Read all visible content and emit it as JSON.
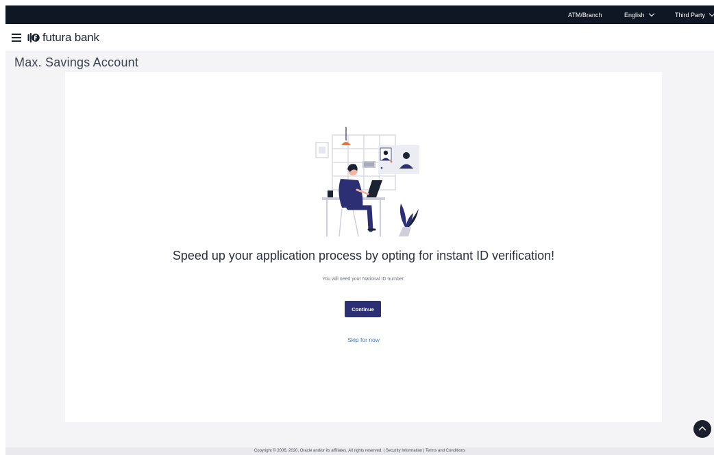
{
  "topbar": {
    "atm_branch": "ATM/Branch",
    "language": "English",
    "third_party": "Third Party"
  },
  "header": {
    "brand_name": "futura bank"
  },
  "page": {
    "title": "Max. Savings Account"
  },
  "main": {
    "headline": "Speed up your application process by opting for instant ID verification!",
    "subline": "You will need your National ID number.",
    "continue_label": "Continue",
    "skip_label": "Skip for now"
  },
  "footer": {
    "copyright": "Copyright © 2006, 2020, Oracle and/or its affiliates. All rights reserved.",
    "separator": " | ",
    "security_info": "Security Information",
    "terms": "Terms and Conditions"
  },
  "colors": {
    "topbar_bg": "#0f1724",
    "primary_button": "#2c2f73",
    "link": "#3b7bbf",
    "page_bg": "#f4f4f6"
  },
  "icons": {
    "menu": "hamburger-menu-icon",
    "language_dropdown": "chevron-down-icon",
    "third_party_dropdown": "chevron-down-icon",
    "scroll_top": "chevron-up-icon",
    "logo": "futura-bank-logo-icon"
  }
}
